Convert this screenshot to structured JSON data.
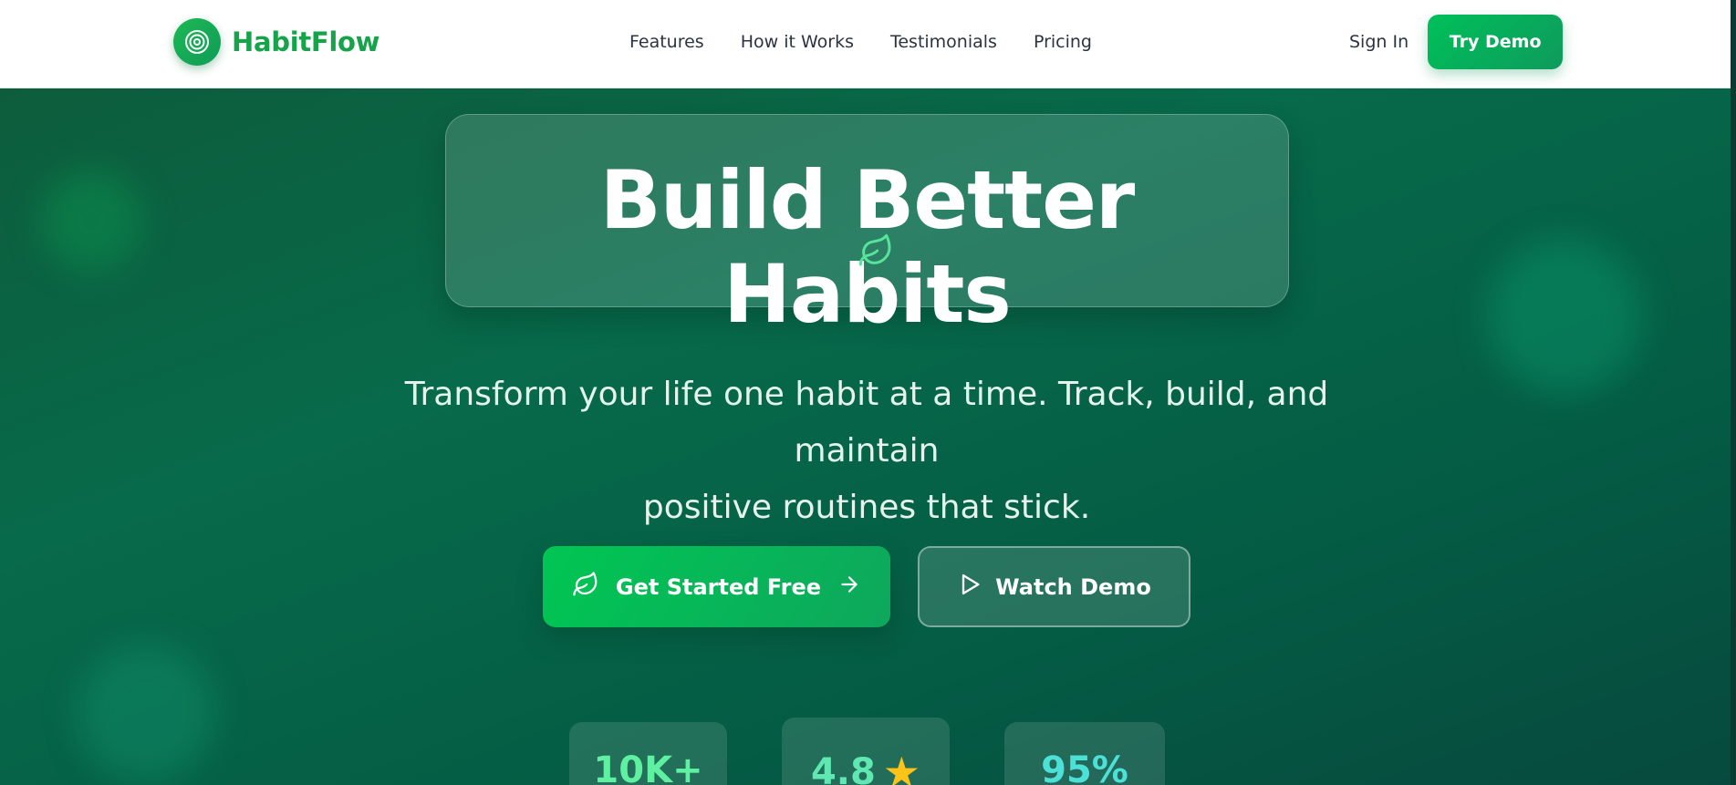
{
  "brand": {
    "name": "HabitFlow",
    "logo_icon": "target-icon",
    "color": "#16a34a"
  },
  "nav": {
    "links": [
      "Features",
      "How it Works",
      "Testimonials",
      "Pricing"
    ],
    "sign_in": "Sign In",
    "try_demo": "Try Demo"
  },
  "hero": {
    "title": "Build Better Habits",
    "title_icon": "leaf-icon",
    "subtitle_line1": "Transform your life one habit at a time. Track, build, and maintain",
    "subtitle_line2": "positive routines that stick.",
    "primary_cta": {
      "label": "Get Started Free",
      "icon_left": "leaf-icon",
      "icon_right": "arrow-right-icon"
    },
    "secondary_cta": {
      "label": "Watch Demo",
      "icon_left": "play-icon"
    },
    "stats": [
      {
        "value": "10K+"
      },
      {
        "value": "4.8",
        "icon": "star-icon"
      },
      {
        "value": "95%"
      }
    ]
  },
  "colors": {
    "accent": "#00c05a",
    "hero_bg": "#076a4a",
    "star": "#fcc419",
    "nav_text": "#2b3440"
  }
}
